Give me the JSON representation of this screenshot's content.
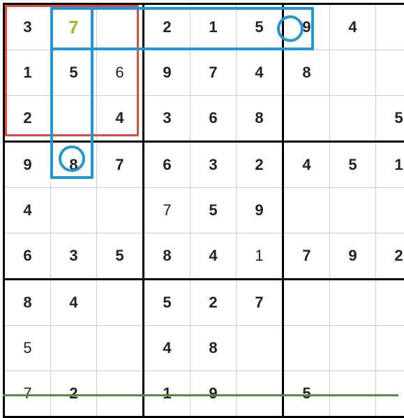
{
  "sudoku": {
    "grid": [
      [
        "3",
        "7",
        "",
        "2",
        "1",
        "5",
        "9",
        "4",
        ""
      ],
      [
        "1",
        "5",
        "6",
        "9",
        "7",
        "4",
        "8",
        "",
        ""
      ],
      [
        "2",
        "",
        "4",
        "3",
        "6",
        "8",
        "",
        "",
        "5"
      ],
      [
        "9",
        "8",
        "7",
        "6",
        "3",
        "2",
        "4",
        "5",
        "1"
      ],
      [
        "4",
        "",
        "",
        "7",
        "5",
        "9",
        "",
        "",
        ""
      ],
      [
        "6",
        "3",
        "5",
        "8",
        "4",
        "1",
        "7",
        "9",
        "2"
      ],
      [
        "8",
        "4",
        "",
        "5",
        "2",
        "7",
        "",
        "",
        ""
      ],
      [
        "5",
        "",
        "",
        "4",
        "8",
        "",
        "",
        "",
        ""
      ],
      [
        "7",
        "2",
        "",
        "1",
        "9",
        "",
        "5",
        "",
        ""
      ]
    ],
    "candidate": {
      "row": 0,
      "col": 1,
      "value": "7"
    },
    "light_cells": [
      {
        "row": 1,
        "col": 2
      },
      {
        "row": 4,
        "col": 3
      },
      {
        "row": 5,
        "col": 5
      },
      {
        "row": 7,
        "col": 0
      },
      {
        "row": 8,
        "col": 0
      }
    ],
    "highlights": {
      "red_box": {
        "row_start": 0,
        "row_end": 2,
        "col_start": 0,
        "col_end": 2
      },
      "blue_row_segment": {
        "row": 0,
        "col_start": 1,
        "col_end": 6
      },
      "blue_col_segment": {
        "col": 1,
        "row_start": 0,
        "row_end": 3
      },
      "blue_circles": [
        {
          "row": 0,
          "col": 6
        },
        {
          "row": 3,
          "col": 1
        }
      ]
    }
  }
}
